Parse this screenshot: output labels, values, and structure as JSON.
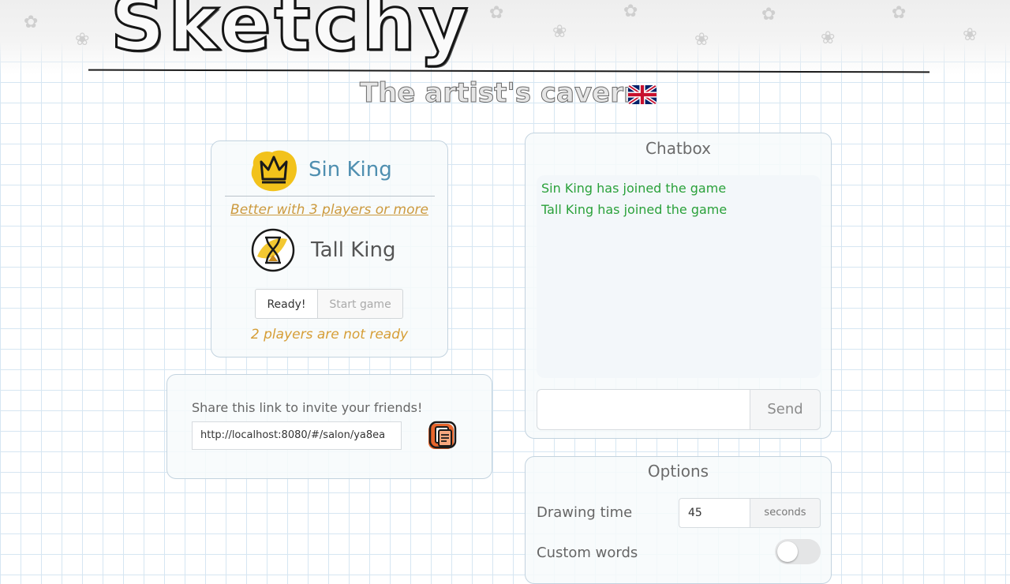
{
  "app": {
    "logo": "Sketchy",
    "tagline": "The artist's cavern"
  },
  "players": {
    "list": [
      {
        "name": "Sin King",
        "color": "#4f8fb0",
        "avatar": "crown-icon"
      },
      {
        "name": "Tall King",
        "color": "#555555",
        "avatar": "hourglass-icon"
      }
    ],
    "hint": "Better with 3 players or more",
    "ready_label": "Ready!",
    "start_label": "Start game",
    "status": "2 players are not ready"
  },
  "share": {
    "label": "Share this link to invite your friends!",
    "link": "http://localhost:8080/#/salon/ya8ea"
  },
  "chat": {
    "title": "Chatbox",
    "messages": [
      "Sin King has joined the game",
      "Tall King has joined the game"
    ],
    "input_value": "",
    "send_label": "Send"
  },
  "options": {
    "title": "Options",
    "drawing_time_label": "Drawing time",
    "drawing_time_value": "45",
    "drawing_time_unit": "seconds",
    "custom_words_label": "Custom words",
    "custom_words_enabled": false
  },
  "colors": {
    "accent_gold": "#d69e36",
    "chat_green": "#2aa13a",
    "player_blue": "#4f8fb0"
  }
}
